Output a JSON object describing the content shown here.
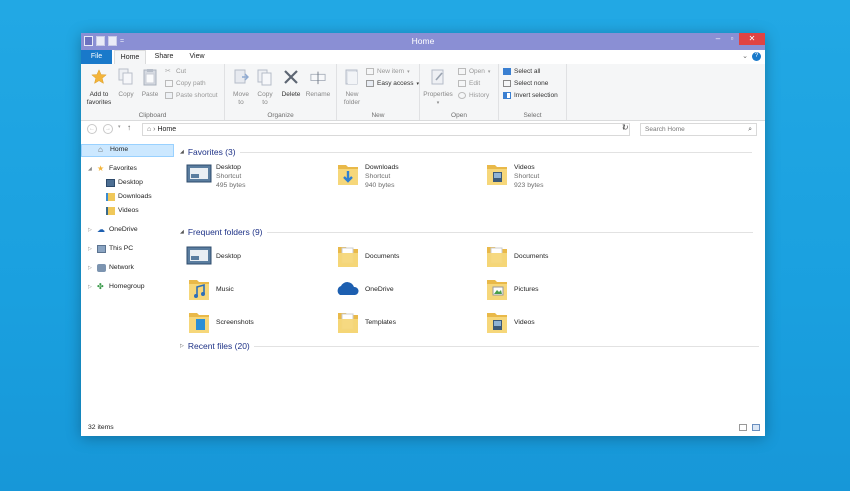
{
  "window": {
    "title": "Home",
    "controls": {
      "minimize": "–",
      "maximize": "▫",
      "close": "✕"
    }
  },
  "quick_access": {
    "dropdown": "="
  },
  "ribbon_tabs": [
    {
      "label": "File"
    },
    {
      "label": "Home"
    },
    {
      "label": "Share"
    },
    {
      "label": "View"
    }
  ],
  "ribbon": {
    "clipboard": {
      "label": "Clipboard",
      "add_to_favorites": "Add to favorites",
      "copy": "Copy",
      "paste": "Paste",
      "cut": "Cut",
      "copy_path": "Copy path",
      "paste_shortcut": "Paste shortcut"
    },
    "organize": {
      "label": "Organize",
      "move_to": "Move to",
      "copy_to": "Copy to",
      "delete": "Delete",
      "rename": "Rename"
    },
    "new": {
      "label": "New",
      "new_folder": "New folder",
      "new_item": "New item",
      "easy_access": "Easy access"
    },
    "open": {
      "label": "Open",
      "properties": "Properties",
      "open": "Open",
      "edit": "Edit",
      "history": "History"
    },
    "select": {
      "label": "Select",
      "select_all": "Select all",
      "select_none": "Select none",
      "invert_selection": "Invert selection"
    }
  },
  "address": {
    "path": "Home",
    "search_placeholder": "Search Home"
  },
  "nav": {
    "home": "Home",
    "favorites": "Favorites",
    "fav_items": [
      "Desktop",
      "Downloads",
      "Videos"
    ],
    "onedrive": "OneDrive",
    "this_pc": "This PC",
    "network": "Network",
    "homegroup": "Homegroup"
  },
  "sections": {
    "favorites": "Favorites (3)",
    "frequent": "Frequent folders (9)",
    "recent": "Recent files (20)"
  },
  "favorites_items": [
    {
      "name": "Desktop",
      "type": "Shortcut",
      "size": "495 bytes"
    },
    {
      "name": "Downloads",
      "type": "Shortcut",
      "size": "940 bytes"
    },
    {
      "name": "Videos",
      "type": "Shortcut",
      "size": "923 bytes"
    }
  ],
  "frequent_items": [
    {
      "name": "Desktop"
    },
    {
      "name": "Documents"
    },
    {
      "name": "Documents"
    },
    {
      "name": "Music"
    },
    {
      "name": "OneDrive"
    },
    {
      "name": "Pictures"
    },
    {
      "name": "Screenshots"
    },
    {
      "name": "Templates"
    },
    {
      "name": "Videos"
    }
  ],
  "status": {
    "count": "32 items"
  },
  "colors": {
    "accent": "#1979ca",
    "titlebar": "#8a8fd4",
    "close": "#e04343",
    "selection": "#cce8ff"
  }
}
